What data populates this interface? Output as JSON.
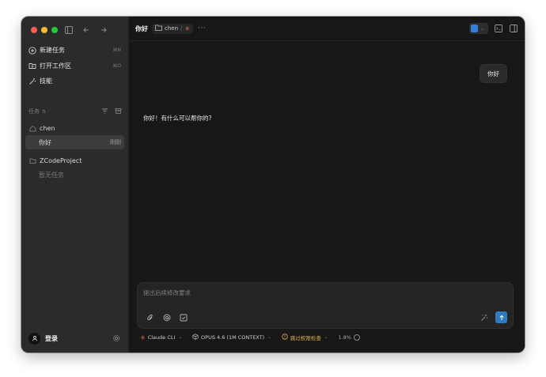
{
  "sidebar": {
    "menu": [
      {
        "label": "新建任务",
        "shortcut": "⌘N"
      },
      {
        "label": "打开工作区",
        "shortcut": "⌘O"
      },
      {
        "label": "技能",
        "shortcut": ""
      }
    ],
    "section_title": "任务",
    "workspaces": [
      {
        "name": "chen",
        "tasks": [
          {
            "title": "你好",
            "time": "刚刚"
          }
        ]
      },
      {
        "name": "ZCodeProject",
        "empty_text": "暂无任务"
      }
    ],
    "login_label": "登录"
  },
  "topbar": {
    "title": "你好",
    "crumb_folder": "chen",
    "crumb_sep": "/",
    "more": "···"
  },
  "chat": {
    "user_message": "你好",
    "assistant_reply": "你好！有什么可以帮你的?"
  },
  "composer": {
    "placeholder": "提出后续修改要求"
  },
  "statusbar": {
    "agent": "Claude CLI",
    "model": "OPUS 4.6 (1M CONTEXT)",
    "permission": "跳过权限检查",
    "context_usage": "1.8%"
  },
  "colors": {
    "accent": "#2e7bbf",
    "warning": "#e0b14b",
    "claude_orange": "#d9774a",
    "traffic_red": "#ff5f57",
    "traffic_yellow": "#febc2e",
    "traffic_green": "#28c840"
  }
}
